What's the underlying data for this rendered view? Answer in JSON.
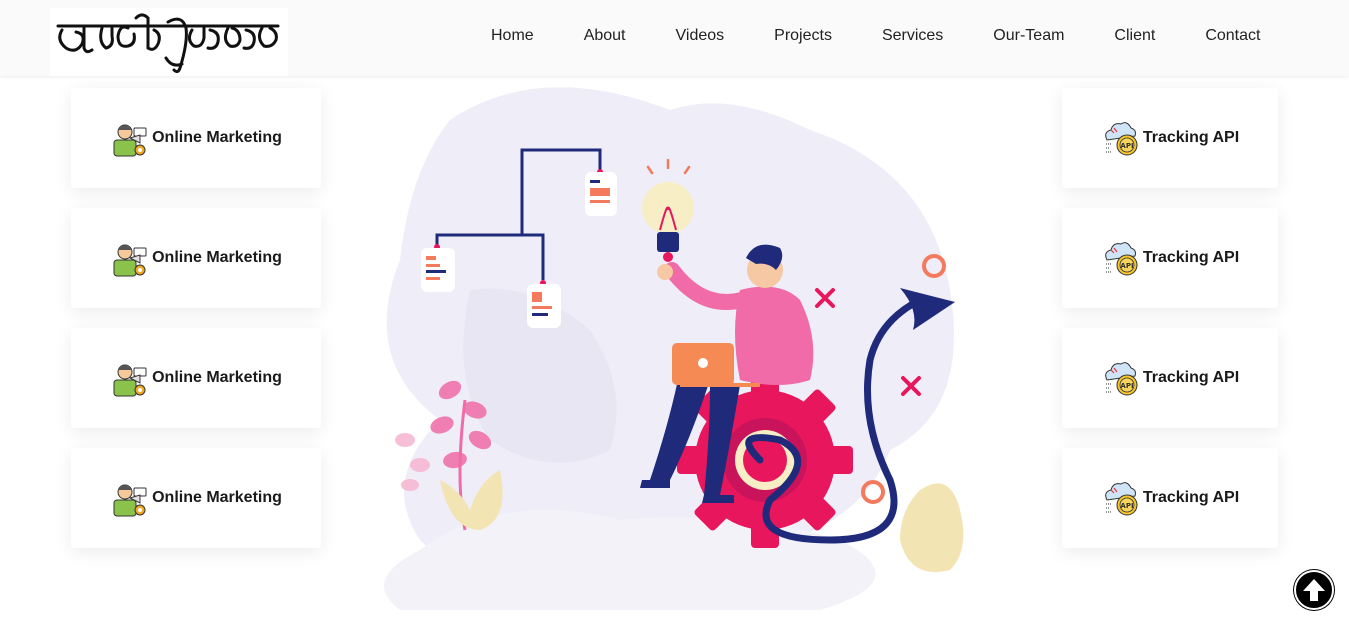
{
  "nav": {
    "logo_alt": "আমি কিছু মহা খাদক",
    "links": [
      "Home",
      "About",
      "Videos",
      "Projects",
      "Services",
      "Our-Team",
      "Client",
      "Contact"
    ]
  },
  "services_left": [
    {
      "label": "Online Marketing",
      "icon": "marketing-person-icon"
    },
    {
      "label": "Online Marketing",
      "icon": "marketing-person-icon"
    },
    {
      "label": "Online Marketing",
      "icon": "marketing-person-icon"
    },
    {
      "label": "Online Marketing",
      "icon": "marketing-person-icon"
    }
  ],
  "services_right": [
    {
      "label": "Tracking API",
      "icon": "api-cloud-gear-icon"
    },
    {
      "label": "Tracking API",
      "icon": "api-cloud-gear-icon"
    },
    {
      "label": "Tracking API",
      "icon": "api-cloud-gear-icon"
    },
    {
      "label": "Tracking API",
      "icon": "api-cloud-gear-icon"
    }
  ],
  "colors": {
    "navbar_bg": "#fafafa",
    "accent_pink": "#f06ba8",
    "accent_magenta": "#e8175d",
    "navy": "#1f2a7a",
    "blob": "#efedf7"
  },
  "back_to_top_icon": "arrow-up-icon"
}
